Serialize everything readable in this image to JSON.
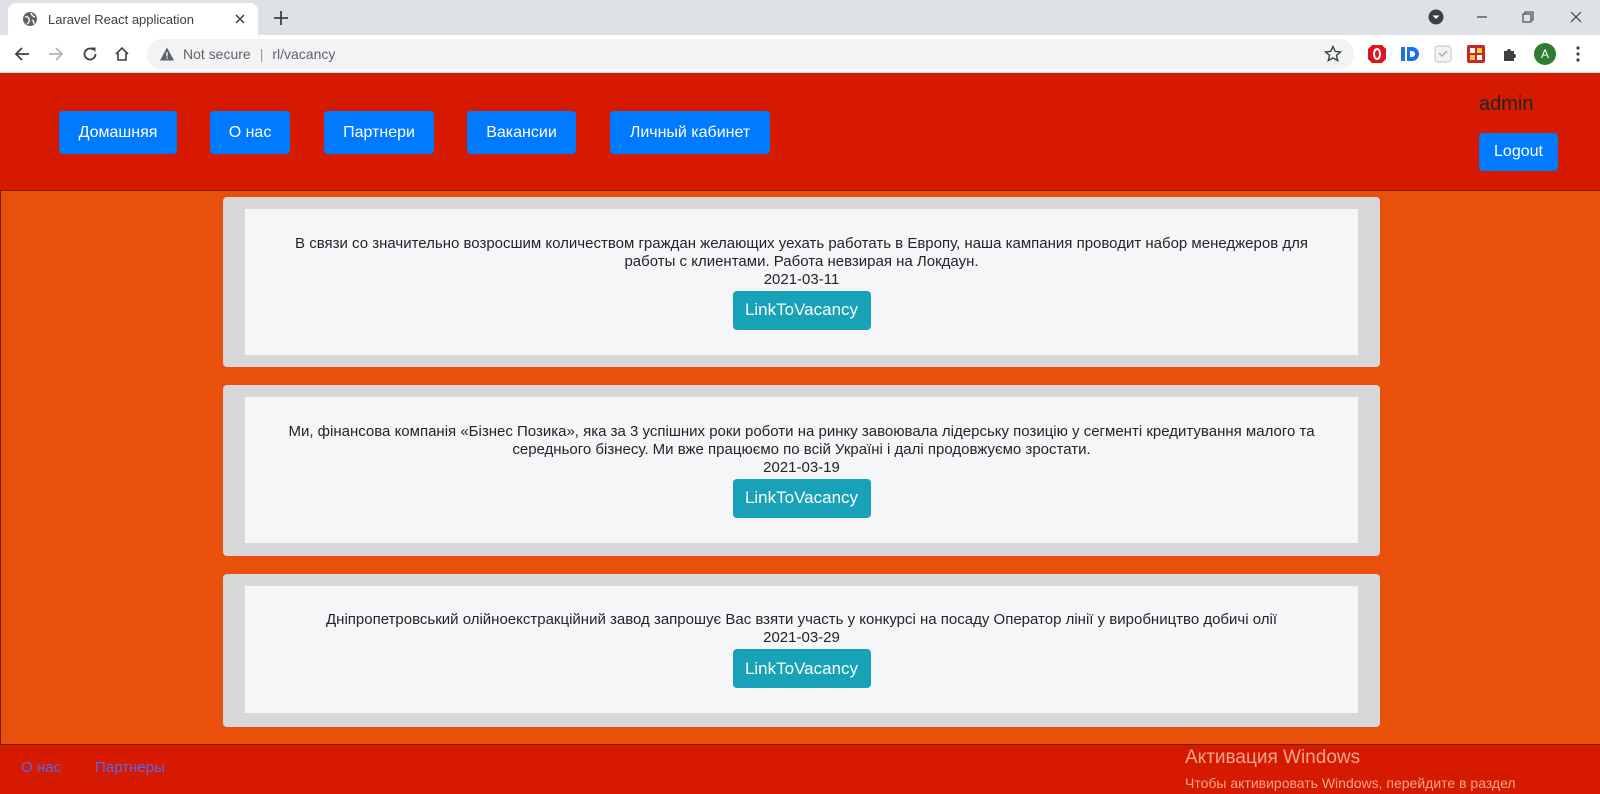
{
  "browser": {
    "tab_title": "Laravel React application",
    "security_label": "Not secure",
    "url": "rl/vacancy",
    "profile_initial": "A"
  },
  "header": {
    "nav": [
      {
        "label": "Домашняя"
      },
      {
        "label": "О нас"
      },
      {
        "label": "Партнери"
      },
      {
        "label": "Вакансии"
      },
      {
        "label": "Личный кабинет"
      }
    ],
    "username": "admin",
    "logout_label": "Logout"
  },
  "vacancies": [
    {
      "text": "В связи со значительно возросшим количеством граждан желающих уехать работать в Европу, наша кампания проводит набор менеджеров для работы с клиентами. Работа невзирая на Локдаун.",
      "date": "2021-03-11",
      "button_label": "LinkToVacancy"
    },
    {
      "text": "Ми, фінансова компанія «Бізнес Позика», яка за 3 успішних роки роботи на ринку завоювала лідерську позицію у сегменті кредитування малого та середнього бізнесу. Ми вже працюємо по всій Україні і далі продовжуємо зростати.",
      "date": "2021-03-19",
      "button_label": "LinkToVacancy"
    },
    {
      "text": "Дніпропетровський олійноекстракційний завод запрошує Вас взяти участь у конкурсі на посаду Оператор лінії у виробництво добичі олії",
      "date": "2021-03-29",
      "button_label": "LinkToVacancy"
    }
  ],
  "footer": {
    "links": [
      {
        "label": "О нас"
      },
      {
        "label": "Партнеры"
      }
    ],
    "activation_title": "Активация Windows",
    "activation_subtitle": "Чтобы активировать Windows, перейдите в раздел"
  },
  "colors": {
    "header_bg": "#d61a00",
    "page_bg": "#e8500b",
    "primary_button": "#007bff",
    "info_button": "#17a2b8"
  }
}
